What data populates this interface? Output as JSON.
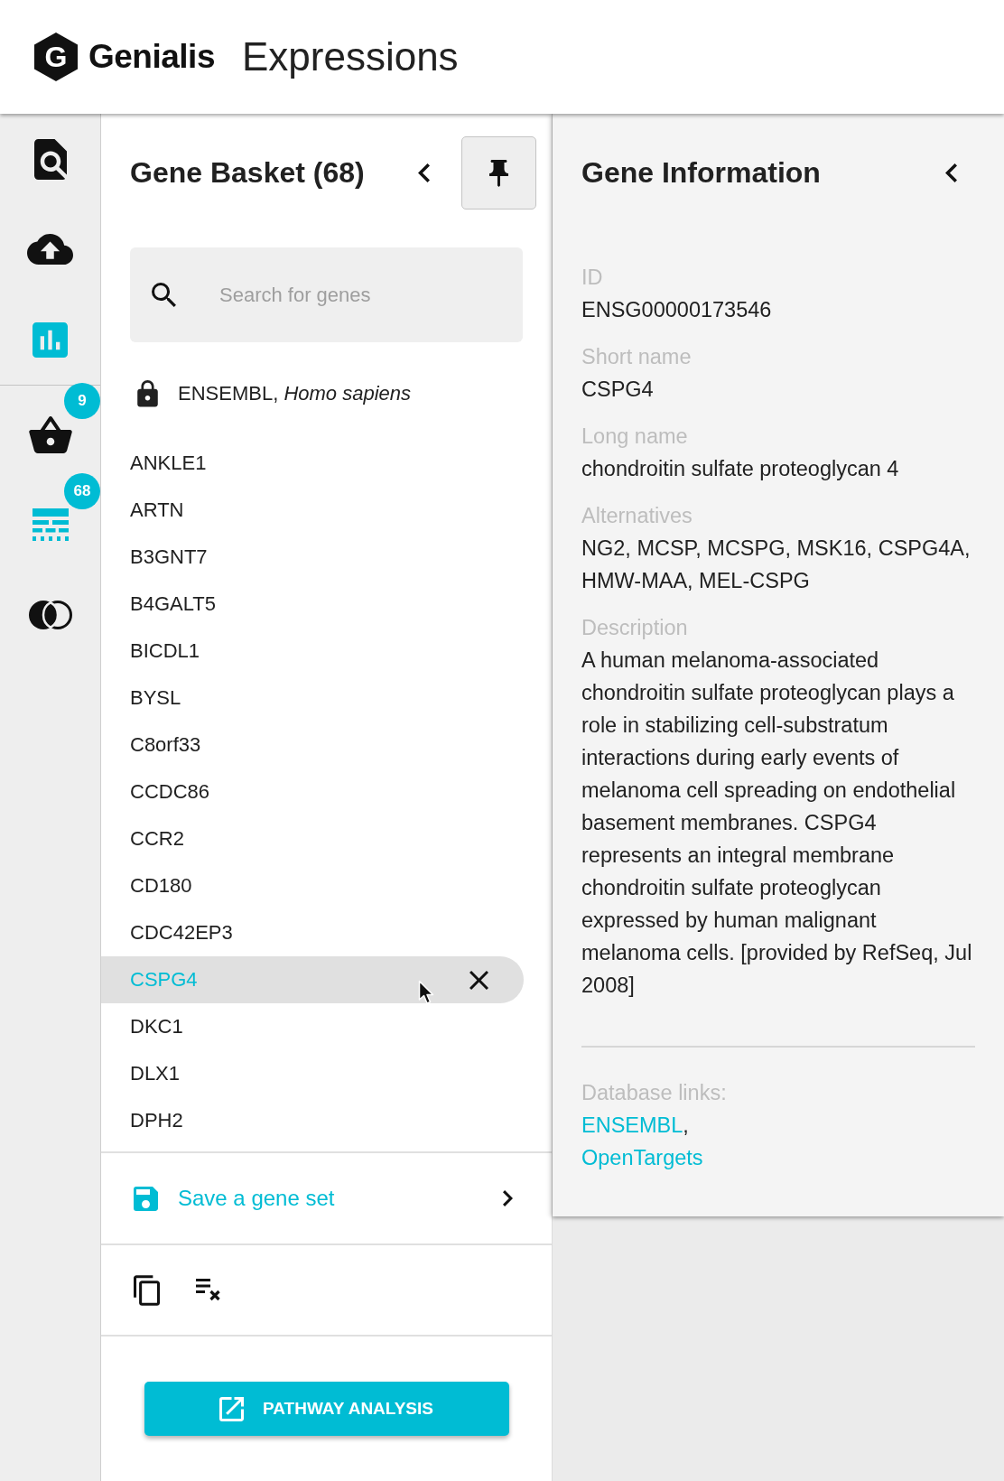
{
  "header": {
    "logo": {
      "mark": "G",
      "name": "Genialis"
    },
    "app_title": "Expressions"
  },
  "nav_rail": {
    "sections": [
      {
        "items": [
          {
            "kind": "find",
            "selected": false
          },
          {
            "kind": "upload",
            "selected": false
          },
          {
            "kind": "chart",
            "selected": true
          }
        ]
      },
      {
        "items": [
          {
            "kind": "basket",
            "selected": false,
            "badge": "9"
          },
          {
            "kind": "gene-list",
            "selected": true,
            "badge": "68"
          },
          {
            "kind": "venn",
            "selected": false
          }
        ]
      }
    ]
  },
  "gene_basket": {
    "title": "Gene Basket (68)",
    "pinned": true,
    "search": {
      "placeholder": "Search for genes"
    },
    "source": "ENSEMBL, *Homo sapiens*",
    "genes": [
      {
        "name": "ANKLE1",
        "selected": false
      },
      {
        "name": "ARTN",
        "selected": false
      },
      {
        "name": "B3GNT7",
        "selected": false
      },
      {
        "name": "B4GALT5",
        "selected": false
      },
      {
        "name": "BICDL1",
        "selected": false
      },
      {
        "name": "BYSL",
        "selected": false
      },
      {
        "name": "C8orf33",
        "selected": false
      },
      {
        "name": "CCDC86",
        "selected": false
      },
      {
        "name": "CCR2",
        "selected": false
      },
      {
        "name": "CD180",
        "selected": false
      },
      {
        "name": "CDC42EP3",
        "selected": false
      },
      {
        "name": "CSPG4",
        "selected": true
      },
      {
        "name": "DKC1",
        "selected": false
      },
      {
        "name": "DLX1",
        "selected": false
      },
      {
        "name": "DPH2",
        "selected": false
      }
    ],
    "save_action": "Save a gene set",
    "action_button": "PATHWAY ANALYSIS"
  },
  "gene_info": {
    "title": "Gene Information",
    "fields": [
      {
        "label": "ID",
        "value": "ENSG00000173546"
      },
      {
        "label": "Short name",
        "value": "CSPG4"
      },
      {
        "label": "Long name",
        "value": "chondroitin sulfate proteoglycan 4"
      },
      {
        "label": "Alternatives",
        "value": "NG2, MCSP, MCSPG, MSK16, CSPG4A, HMW-MAA, MEL-CSPG"
      },
      {
        "label": "Description",
        "value": "A human melanoma-associated chondroitin sulfate proteoglycan plays a role in stabilizing cell-substratum interactions during early events of melanoma cell spreading on endothelial basement membranes. CSPG4 represents an integral membrane chondroitin sulfate proteoglycan expressed by human malignant melanoma cells. [provided by RefSeq, Jul 2008]"
      }
    ],
    "links_label": "Database links:",
    "links": [
      {
        "text": "ENSEMBL",
        "separator": ","
      },
      {
        "text": "OpenTargets"
      }
    ]
  }
}
